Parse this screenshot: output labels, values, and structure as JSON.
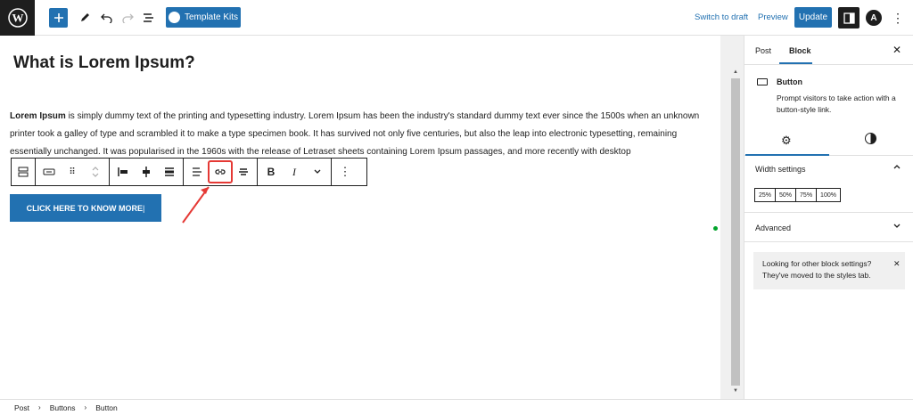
{
  "topbar": {
    "template_kits": "Template Kits",
    "switch_to_draft": "Switch to draft",
    "preview": "Preview",
    "update": "Update",
    "astra_letter": "A"
  },
  "content": {
    "heading": "What is Lorem Ipsum?",
    "para_bold": "Lorem Ipsum",
    "para_rest": " is simply dummy text of the printing and typesetting industry. Lorem Ipsum has been the industry's standard dummy text ever since the 1500s when an unknown printer took a galley of type and scrambled it to make a type specimen book. It has survived not only five centuries, but also the leap into electronic typesetting, remaining essentially unchanged. It was popularised in the 1960s with the release of Letraset sheets containing Lorem Ipsum passages, and more recently with desktop",
    "button_text": "CLICK HERE TO KNOW MORE"
  },
  "sidebar": {
    "tabs": [
      "Post",
      "Block"
    ],
    "block_name": "Button",
    "block_desc": "Prompt visitors to take action with a button-style link.",
    "width_settings": "Width settings",
    "width_options": [
      "25%",
      "50%",
      "75%",
      "100%"
    ],
    "advanced": "Advanced",
    "notice": "Looking for other block settings? They've moved to the styles tab."
  },
  "breadcrumbs": [
    "Post",
    "Buttons",
    "Button"
  ],
  "colors": {
    "accent": "#2271b1",
    "highlight": "#e53935",
    "dark": "#1e1e1e"
  }
}
